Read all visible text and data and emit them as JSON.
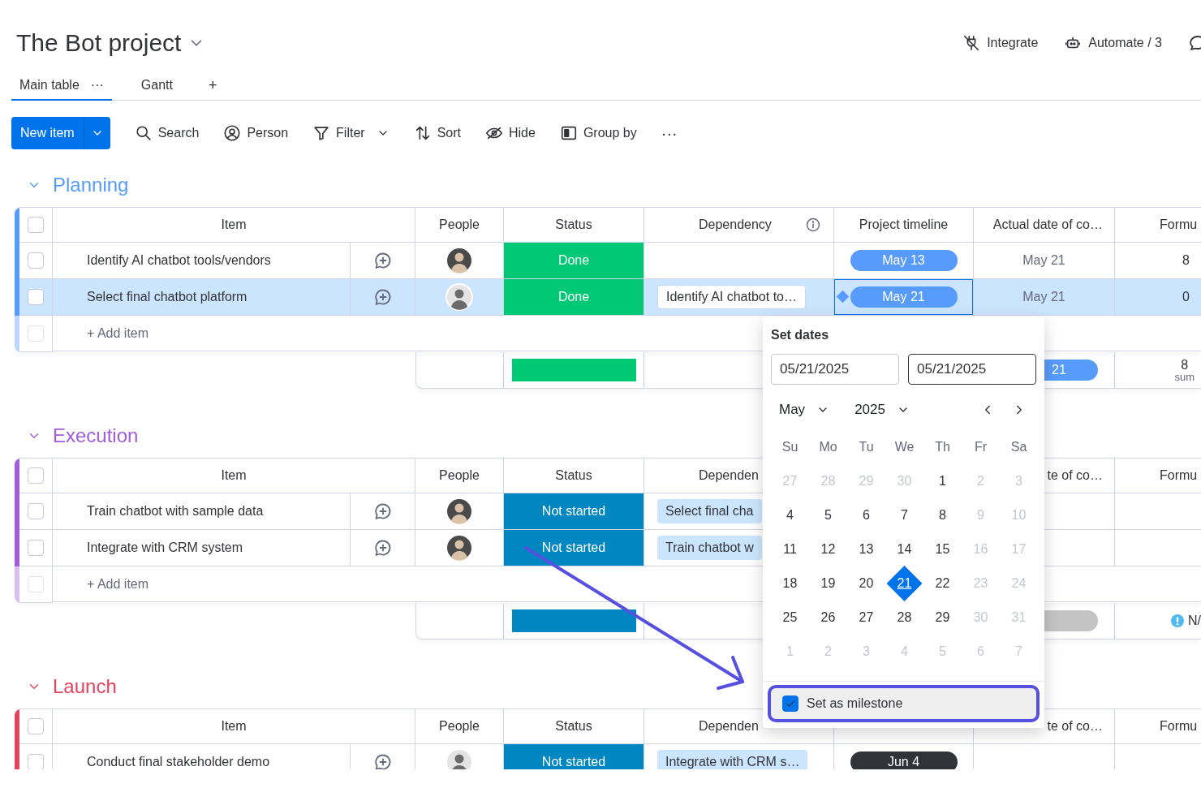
{
  "board": {
    "title": "The Bot project"
  },
  "header_actions": [
    {
      "kind": "integrate",
      "label": "Integrate"
    },
    {
      "kind": "automate",
      "label": "Automate / 3"
    },
    {
      "kind": "chat"
    }
  ],
  "views": [
    {
      "label": "Main table",
      "menu": "···",
      "selected": true
    },
    {
      "label": "Gantt",
      "selected": false
    }
  ],
  "add_view": "+",
  "toolbar": {
    "new_item": "New item",
    "tools": [
      {
        "kind": "search",
        "label": "Search"
      },
      {
        "kind": "person",
        "label": "Person"
      },
      {
        "kind": "filter",
        "label": "Filter",
        "dropdown": true
      },
      {
        "kind": "sort",
        "label": "Sort"
      },
      {
        "kind": "hide",
        "label": "Hide"
      },
      {
        "kind": "group",
        "label": "Group by"
      },
      {
        "kind": "more",
        "label": "···"
      }
    ]
  },
  "groups": [
    {
      "name": "Planning",
      "color": "#579bfc",
      "expanded": true,
      "headers": {
        "checked": false,
        "item": "Item",
        "people": "People",
        "status": "Status",
        "dependency": "Dependency",
        "dependency_info": true,
        "timeline": "Project timeline",
        "actual": "Actual date of co…",
        "formula": "Formu"
      },
      "rows": [
        {
          "item": "Identify AI chatbot tools/vendors",
          "checked": false,
          "selected": false,
          "avatar": {
            "kind": "dark"
          },
          "status": {
            "label": "Done",
            "color": "#00c875"
          },
          "timeline": {
            "label": "May 13",
            "color": "#579bfc"
          },
          "milestone": false,
          "actual": "May 21",
          "formula": "8"
        },
        {
          "item": "Select final chatbot platform",
          "checked": false,
          "selected": true,
          "avatar": {
            "kind": "light"
          },
          "status": {
            "label": "Done",
            "color": "#00c875"
          },
          "dependency": "Identify AI chatbot to…",
          "timeline": {
            "label": "May 21",
            "color": "#579bfc"
          },
          "milestone": true,
          "actual": "May 21",
          "formula": "0"
        }
      ],
      "add_row": {
        "label": "+ Add item",
        "checked": false
      },
      "summary": {
        "status": {
          "color": "#00c875"
        },
        "actual": {
          "label": "21",
          "color": "#579bfc"
        },
        "formula": "8",
        "formula_note": "sum"
      }
    },
    {
      "name": "Execution",
      "color": "#a25ddc",
      "expanded": true,
      "headers": {
        "checked": false,
        "item": "Item",
        "people": "People",
        "status": "Status",
        "dependency": "Dependen",
        "actual": "te of co…",
        "formula": "Formu"
      },
      "rows": [
        {
          "item": "Train chatbot with sample data",
          "checked": false,
          "selected": false,
          "avatar": {
            "kind": "dark"
          },
          "status": {
            "label": "Not started",
            "color": "#0086c0"
          },
          "dependency": "Select final cha"
        },
        {
          "item": "Integrate with CRM system",
          "checked": false,
          "selected": false,
          "avatar": {
            "kind": "dark"
          },
          "status": {
            "label": "Not started",
            "color": "#0086c0"
          },
          "dependency": "Train chatbot w"
        }
      ],
      "add_row": {
        "label": "+ Add item",
        "checked": false
      },
      "summary": {
        "status": {
          "color": "#0086c0"
        },
        "actual": {
          "color": "#c4c4c4"
        },
        "formula": "N/",
        "formula_warning": true
      }
    },
    {
      "name": "Launch",
      "color": "#e2445c",
      "expanded": true,
      "headers": {
        "checked": false,
        "item": "Item",
        "people": "People",
        "status": "Status",
        "dependency": "Dependen",
        "actual": "te of co…",
        "formula": "Formu"
      },
      "rows": [
        {
          "item": "Conduct final stakeholder demo",
          "checked": false,
          "selected": false,
          "avatar": {
            "kind": "light"
          },
          "status": {
            "label": "Not started",
            "color": "#0086c0"
          },
          "dependency": "Integrate with CRM s…",
          "timeline": {
            "label": "Jun 4",
            "color": "#323338"
          },
          "milestone": false
        }
      ]
    }
  ],
  "date_picker": {
    "title": "Set dates",
    "fields": [
      {
        "value": "05/21/2025",
        "focused": false
      },
      {
        "value": "05/21/2025",
        "focused": true
      }
    ],
    "month": "May",
    "year": "2025",
    "weekdays": [
      "Su",
      "Mo",
      "Tu",
      "We",
      "Th",
      "Fr",
      "Sa"
    ],
    "weeks": [
      [
        {
          "d": "27",
          "muted": true,
          "selected": false
        },
        {
          "d": "28",
          "muted": true,
          "selected": false
        },
        {
          "d": "29",
          "muted": true,
          "selected": false
        },
        {
          "d": "30",
          "muted": true,
          "selected": false
        },
        {
          "d": "1",
          "muted": false,
          "selected": false
        },
        {
          "d": "2",
          "muted": true,
          "selected": false
        },
        {
          "d": "3",
          "muted": true,
          "selected": false
        }
      ],
      [
        {
          "d": "4",
          "muted": false,
          "selected": false
        },
        {
          "d": "5",
          "muted": false,
          "selected": false
        },
        {
          "d": "6",
          "muted": false,
          "selected": false
        },
        {
          "d": "7",
          "muted": false,
          "selected": false
        },
        {
          "d": "8",
          "muted": false,
          "selected": false
        },
        {
          "d": "9",
          "muted": true,
          "selected": false
        },
        {
          "d": "10",
          "muted": true,
          "selected": false
        }
      ],
      [
        {
          "d": "11",
          "muted": false,
          "selected": false
        },
        {
          "d": "12",
          "muted": false,
          "selected": false
        },
        {
          "d": "13",
          "muted": false,
          "selected": false
        },
        {
          "d": "14",
          "muted": false,
          "selected": false
        },
        {
          "d": "15",
          "muted": false,
          "selected": false
        },
        {
          "d": "16",
          "muted": true,
          "selected": false
        },
        {
          "d": "17",
          "muted": true,
          "selected": false
        }
      ],
      [
        {
          "d": "18",
          "muted": false,
          "selected": false
        },
        {
          "d": "19",
          "muted": false,
          "selected": false
        },
        {
          "d": "20",
          "muted": false,
          "selected": false
        },
        {
          "d": "21",
          "muted": false,
          "selected": true
        },
        {
          "d": "22",
          "muted": false,
          "selected": false
        },
        {
          "d": "23",
          "muted": true,
          "selected": false
        },
        {
          "d": "24",
          "muted": true,
          "selected": false
        }
      ],
      [
        {
          "d": "25",
          "muted": false,
          "selected": false
        },
        {
          "d": "26",
          "muted": false,
          "selected": false
        },
        {
          "d": "27",
          "muted": false,
          "selected": false
        },
        {
          "d": "28",
          "muted": false,
          "selected": false
        },
        {
          "d": "29",
          "muted": false,
          "selected": false
        },
        {
          "d": "30",
          "muted": true,
          "selected": false
        },
        {
          "d": "31",
          "muted": true,
          "selected": false
        }
      ],
      [
        {
          "d": "1",
          "muted": true,
          "selected": false
        },
        {
          "d": "2",
          "muted": true,
          "selected": false
        },
        {
          "d": "3",
          "muted": true,
          "selected": false
        },
        {
          "d": "4",
          "muted": true,
          "selected": false
        },
        {
          "d": "5",
          "muted": true,
          "selected": false
        },
        {
          "d": "6",
          "muted": true,
          "selected": false
        },
        {
          "d": "7",
          "muted": true,
          "selected": false
        }
      ]
    ],
    "milestone": {
      "label": "Set as milestone",
      "checked": true,
      "highlighted": true
    }
  },
  "annotation_arrow": true
}
